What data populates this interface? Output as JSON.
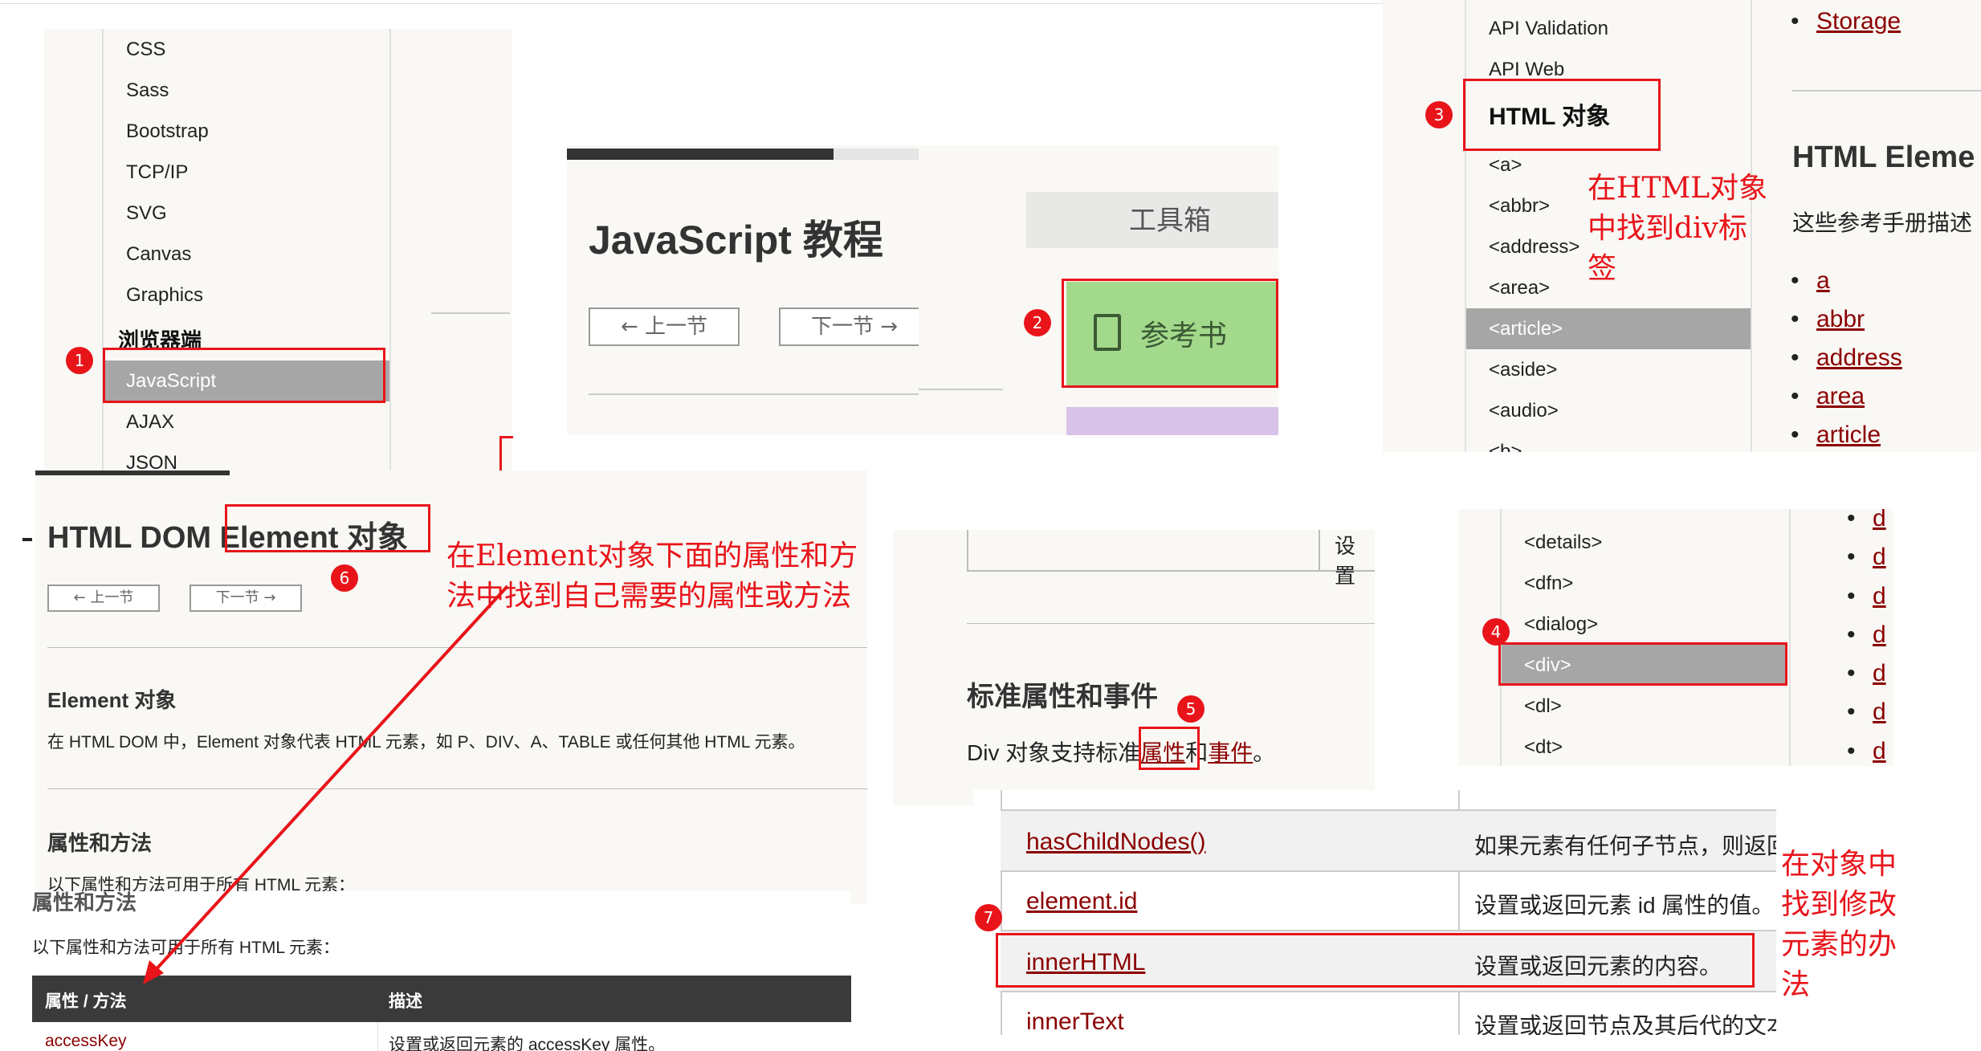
{
  "panel_nav": {
    "items": [
      "CSS",
      "Sass",
      "Bootstrap",
      "TCP/IP",
      "SVG",
      "Canvas",
      "Graphics"
    ],
    "section": "浏览器端",
    "active": "JavaScript",
    "after": [
      "AJAX",
      "JSON"
    ]
  },
  "panel_title": {
    "title": "JavaScript 教程",
    "prev": "上一节",
    "next": "下一节",
    "toolbox": "工具箱",
    "reference": "参考书"
  },
  "panel_objects": {
    "items_top": [
      "API Validation",
      "API Web"
    ],
    "header": "HTML 对象",
    "items": [
      "<a>",
      "<abbr>",
      "<address>",
      "<area>",
      "<article>",
      "<aside>",
      "<audio>",
      "<b>"
    ],
    "active": "<article>",
    "right_link_top": "Storage",
    "right_heading": "HTML Eleme",
    "right_desc": "这些参考手册描述",
    "right_links": [
      "a",
      "abbr",
      "address",
      "area",
      "article"
    ]
  },
  "panel_dom": {
    "title_prefix": "HTML DOM ",
    "title_box": "Element 对象",
    "prev": "上一节",
    "next": "下一节",
    "section1": "Element 对象",
    "desc": "在 HTML DOM 中，Element 对象代表 HTML 元素，如 P、DIV、A、TABLE 或任何其他 HTML 元素。",
    "section2": "属性和方法",
    "desc2": "以下属性和方法可用于所有 HTML 元素：",
    "section2_dup": "属性和方法",
    "desc2_dup": "以下属性和方法可用于所有 HTML 元素：",
    "col1": "属性 / 方法",
    "col2": "描述",
    "row_name": "accessKey",
    "row_desc": "设置或返回元素的 accessKey 属性。"
  },
  "panel_div": {
    "cell": "设置",
    "heading": "标准属性和事件",
    "text_prefix": "Div 对象支持标准",
    "link1": "属性",
    "and": "和",
    "link2": "事件",
    "end": "。"
  },
  "panel_tags": {
    "items": [
      "<details>",
      "<dfn>",
      "<dialog>",
      "<div>",
      "<dl>",
      "<dt>"
    ],
    "active": "<div>",
    "right_links": [
      "d",
      "d",
      "d",
      "d",
      "d",
      "d",
      "d"
    ]
  },
  "panel_table": {
    "rows": [
      {
        "name": "hasChildNodes()",
        "desc": "如果元素有任何子节点，则返回"
      },
      {
        "name": "element.id",
        "desc": "设置或返回元素 id 属性的值。"
      },
      {
        "name": "innerHTML",
        "desc": "设置或返回元素的内容。"
      },
      {
        "name": "innerText",
        "desc": "设置或返回节点及其后代的文本"
      }
    ]
  },
  "annotations": {
    "n1": "1",
    "n2": "2",
    "n3": "3",
    "n4": "4",
    "n5": "5",
    "n6": "6",
    "n7": "7",
    "note_html": "在HTML对象中找到div标签",
    "note_element": "在Element对象下面的属性和方法中找到自己需要的属性或方法",
    "note_object": "在对象中找到修改元素的办法"
  },
  "colors": {
    "accent": "#e8141a",
    "active_bg": "#a6a6a6",
    "link": "#8b0000",
    "reference_bg": "#a3d98b"
  }
}
